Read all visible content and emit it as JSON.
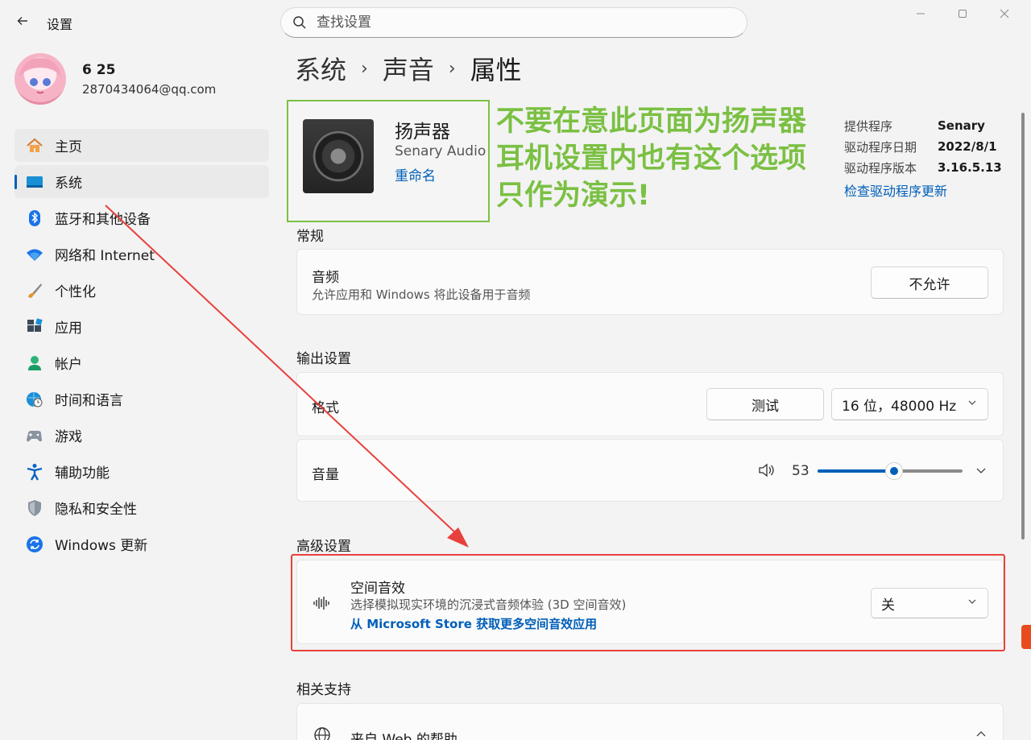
{
  "window": {
    "title": "设置",
    "search_placeholder": "查找设置"
  },
  "profile": {
    "name": "6 25",
    "email": "2870434064@qq.com"
  },
  "sidebar": {
    "items": [
      {
        "label": "主页",
        "icon": "home-icon"
      },
      {
        "label": "系统",
        "icon": "system-icon"
      },
      {
        "label": "蓝牙和其他设备",
        "icon": "bluetooth-icon"
      },
      {
        "label": "网络和 Internet",
        "icon": "wifi-icon"
      },
      {
        "label": "个性化",
        "icon": "brush-icon"
      },
      {
        "label": "应用",
        "icon": "apps-icon"
      },
      {
        "label": "帐户",
        "icon": "person-icon"
      },
      {
        "label": "时间和语言",
        "icon": "globe-clock-icon"
      },
      {
        "label": "游戏",
        "icon": "gamepad-icon"
      },
      {
        "label": "辅助功能",
        "icon": "accessibility-icon"
      },
      {
        "label": "隐私和安全性",
        "icon": "shield-icon"
      },
      {
        "label": "Windows 更新",
        "icon": "update-icon"
      }
    ]
  },
  "breadcrumb": {
    "level1": "系统",
    "level2": "声音",
    "current": "属性",
    "separator": "›"
  },
  "device": {
    "name": "扬声器",
    "vendor": "Senary Audio",
    "rename_link": "重命名"
  },
  "annotation": {
    "line1": "不要在意此页面为扬声器",
    "line2": "耳机设置内也有这个选项",
    "line3": "只作为演示!",
    "color": "#7bc043"
  },
  "driver": {
    "provider_label": "提供程序",
    "provider_value": "Senary",
    "date_label": "驱动程序日期",
    "date_value": "2022/8/1",
    "version_label": "驱动程序版本",
    "version_value": "3.16.5.13",
    "update_link": "检查驱动程序更新"
  },
  "general": {
    "section_title": "常规",
    "audio_title": "音频",
    "audio_desc": "允许应用和 Windows 将此设备用于音频",
    "audio_button": "不允许"
  },
  "output": {
    "section_title": "输出设置",
    "format_title": "格式",
    "test_button": "测试",
    "format_value": "16 位，48000 Hz",
    "volume_title": "音量",
    "volume_value": "53",
    "volume_level": 53
  },
  "advanced": {
    "section_title": "高级设置",
    "spatial_title": "空间音效",
    "spatial_desc": "选择模拟现实环境的沉浸式音频体验 (3D 空间音效)",
    "spatial_link": "从 Microsoft Store 获取更多空间音效应用",
    "spatial_value": "关"
  },
  "support": {
    "section_title": "相关支持",
    "help_title": "来自 Web 的帮助"
  },
  "colors": {
    "accent": "#005fb8",
    "annotation_border": "#7bc043",
    "highlight_red": "#e8413d"
  }
}
